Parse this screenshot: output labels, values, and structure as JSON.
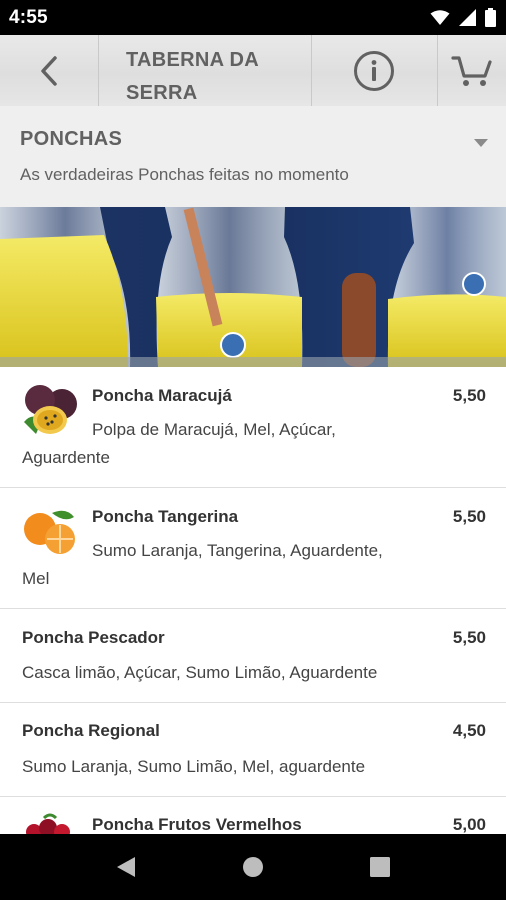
{
  "status_bar": {
    "time": "4:55",
    "icons": [
      "wifi-icon",
      "signal-icon",
      "battery-icon"
    ]
  },
  "app_bar": {
    "title_line1": "TABERNA DA",
    "title_line2": "SERRA",
    "icons": [
      "back-arrow-icon",
      "info-icon",
      "cart-icon"
    ]
  },
  "category": {
    "title": "PONCHAS",
    "subtitle": "As verdadeiras Ponchas feitas no momento",
    "icon": "caret-down-icon"
  },
  "items": [
    {
      "name": "Poncha Maracujá",
      "price": "5,50",
      "desc_line1": "Polpa de Maracujá, Mel, Açúcar,",
      "desc_line2": "Aguardente",
      "image": "passion-fruit"
    },
    {
      "name": "Poncha Tangerina",
      "price": "5,50",
      "desc_line1": "Sumo Laranja, Tangerina, Aguardente,",
      "desc_line2": "Mel",
      "image": "tangerine"
    },
    {
      "name": "Poncha Pescador",
      "price": "5,50",
      "desc": "Casca limão, Açúcar, Sumo Limão, Aguardente"
    },
    {
      "name": "Poncha Regional",
      "price": "4,50",
      "desc": "Sumo Laranja, Sumo Limão, Mel, aguardente"
    },
    {
      "name": "Poncha Frutos Vermelhos",
      "price": "5,00",
      "image": "red-berries"
    }
  ],
  "nav_bar": {
    "icons": [
      "nav-back-icon",
      "nav-home-icon",
      "nav-recents-icon"
    ]
  },
  "colors": {
    "header_text": "#616161",
    "app_bar_bg": "#e3e3e3",
    "category_bg": "#efefef"
  }
}
